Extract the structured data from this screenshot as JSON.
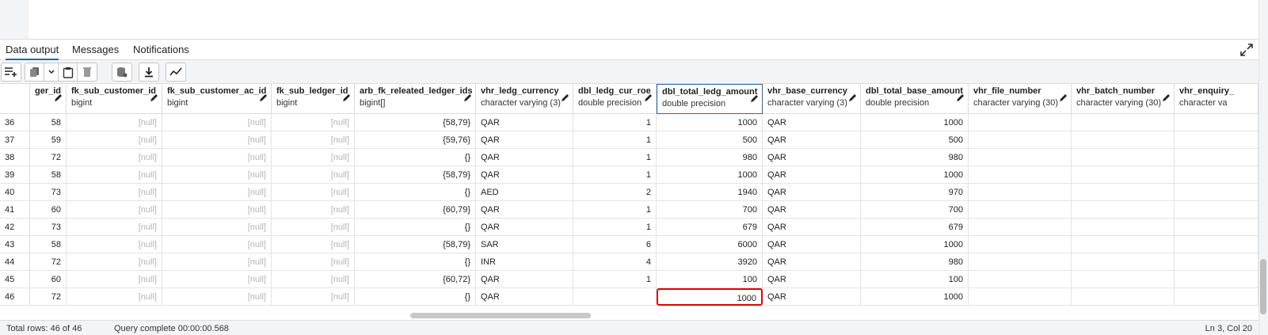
{
  "tabs": [
    {
      "label": "Data output",
      "active": true
    },
    {
      "label": "Messages",
      "active": false
    },
    {
      "label": "Notifications",
      "active": false
    }
  ],
  "toolbar": {
    "buttons": [
      "add-row-icon",
      "copy-icon",
      "chevron-down-icon",
      "paste-icon",
      "delete-icon",
      "save-data-icon",
      "download-icon",
      "graph-icon"
    ]
  },
  "columns": [
    {
      "name": "ger_id",
      "type": "",
      "align": "r"
    },
    {
      "name": "fk_sub_customer_id",
      "type": "bigint",
      "align": "r"
    },
    {
      "name": "fk_sub_customer_ac_id",
      "type": "bigint",
      "align": "r"
    },
    {
      "name": "fk_sub_ledger_id",
      "type": "bigint",
      "align": "r"
    },
    {
      "name": "arb_fk_releated_ledger_ids",
      "type": "bigint[]",
      "align": "r"
    },
    {
      "name": "vhr_ledg_currency",
      "type": "character varying (3)",
      "align": "l"
    },
    {
      "name": "dbl_ledg_cur_roe",
      "type": "double precision",
      "align": "r"
    },
    {
      "name": "dbl_total_ledg_amount",
      "type": "double precision",
      "align": "r",
      "selected": true
    },
    {
      "name": "vhr_base_currency",
      "type": "character varying (3)",
      "align": "l"
    },
    {
      "name": "dbl_total_base_amount",
      "type": "double precision",
      "align": "r"
    },
    {
      "name": "vhr_file_number",
      "type": "character varying (30)",
      "align": "l"
    },
    {
      "name": "vhr_batch_number",
      "type": "character varying (30)",
      "align": "l"
    },
    {
      "name": "vhr_enquiry_",
      "type": "character va",
      "align": "l"
    }
  ],
  "rows": [
    {
      "num": "36",
      "cells": [
        "58",
        "[null]",
        "[null]",
        "[null]",
        "{58,79}",
        "QAR",
        "1",
        "1000",
        "QAR",
        "1000",
        "",
        "",
        ""
      ]
    },
    {
      "num": "37",
      "cells": [
        "59",
        "[null]",
        "[null]",
        "[null]",
        "{59,76}",
        "QAR",
        "1",
        "500",
        "QAR",
        "500",
        "",
        "",
        ""
      ]
    },
    {
      "num": "38",
      "cells": [
        "72",
        "[null]",
        "[null]",
        "[null]",
        "{}",
        "QAR",
        "1",
        "980",
        "QAR",
        "980",
        "",
        "",
        ""
      ]
    },
    {
      "num": "39",
      "cells": [
        "58",
        "[null]",
        "[null]",
        "[null]",
        "{58,79}",
        "QAR",
        "1",
        "1000",
        "QAR",
        "1000",
        "",
        "",
        ""
      ]
    },
    {
      "num": "40",
      "cells": [
        "73",
        "[null]",
        "[null]",
        "[null]",
        "{}",
        "AED",
        "2",
        "1940",
        "QAR",
        "970",
        "",
        "",
        ""
      ]
    },
    {
      "num": "41",
      "cells": [
        "60",
        "[null]",
        "[null]",
        "[null]",
        "{60,79}",
        "QAR",
        "1",
        "700",
        "QAR",
        "700",
        "",
        "",
        ""
      ]
    },
    {
      "num": "42",
      "cells": [
        "73",
        "[null]",
        "[null]",
        "[null]",
        "{}",
        "QAR",
        "1",
        "679",
        "QAR",
        "679",
        "",
        "",
        ""
      ]
    },
    {
      "num": "43",
      "cells": [
        "58",
        "[null]",
        "[null]",
        "[null]",
        "{58,79}",
        "SAR",
        "6",
        "6000",
        "QAR",
        "1000",
        "",
        "",
        ""
      ]
    },
    {
      "num": "44",
      "cells": [
        "72",
        "[null]",
        "[null]",
        "[null]",
        "{}",
        "INR",
        "4",
        "3920",
        "QAR",
        "980",
        "",
        "",
        ""
      ]
    },
    {
      "num": "45",
      "cells": [
        "60",
        "[null]",
        "[null]",
        "[null]",
        "{60,72}",
        "QAR",
        "1",
        "100",
        "QAR",
        "100",
        "",
        "",
        ""
      ]
    },
    {
      "num": "46",
      "cells": [
        "72",
        "[null]",
        "[null]",
        "[null]",
        "{}",
        "QAR",
        "",
        "1000",
        "QAR",
        "1000",
        "",
        "",
        ""
      ]
    }
  ],
  "highlight": {
    "row": 10,
    "col": 7,
    "color": "#e60000"
  },
  "status": {
    "left": "Total rows: 46 of 46",
    "middle": "Query complete 00:00:00.568",
    "right": "Ln 3, Col 20"
  },
  "colors": {
    "accent": "#326690",
    "highlight": "#e60000",
    "null_text": "#b5b5b5"
  }
}
